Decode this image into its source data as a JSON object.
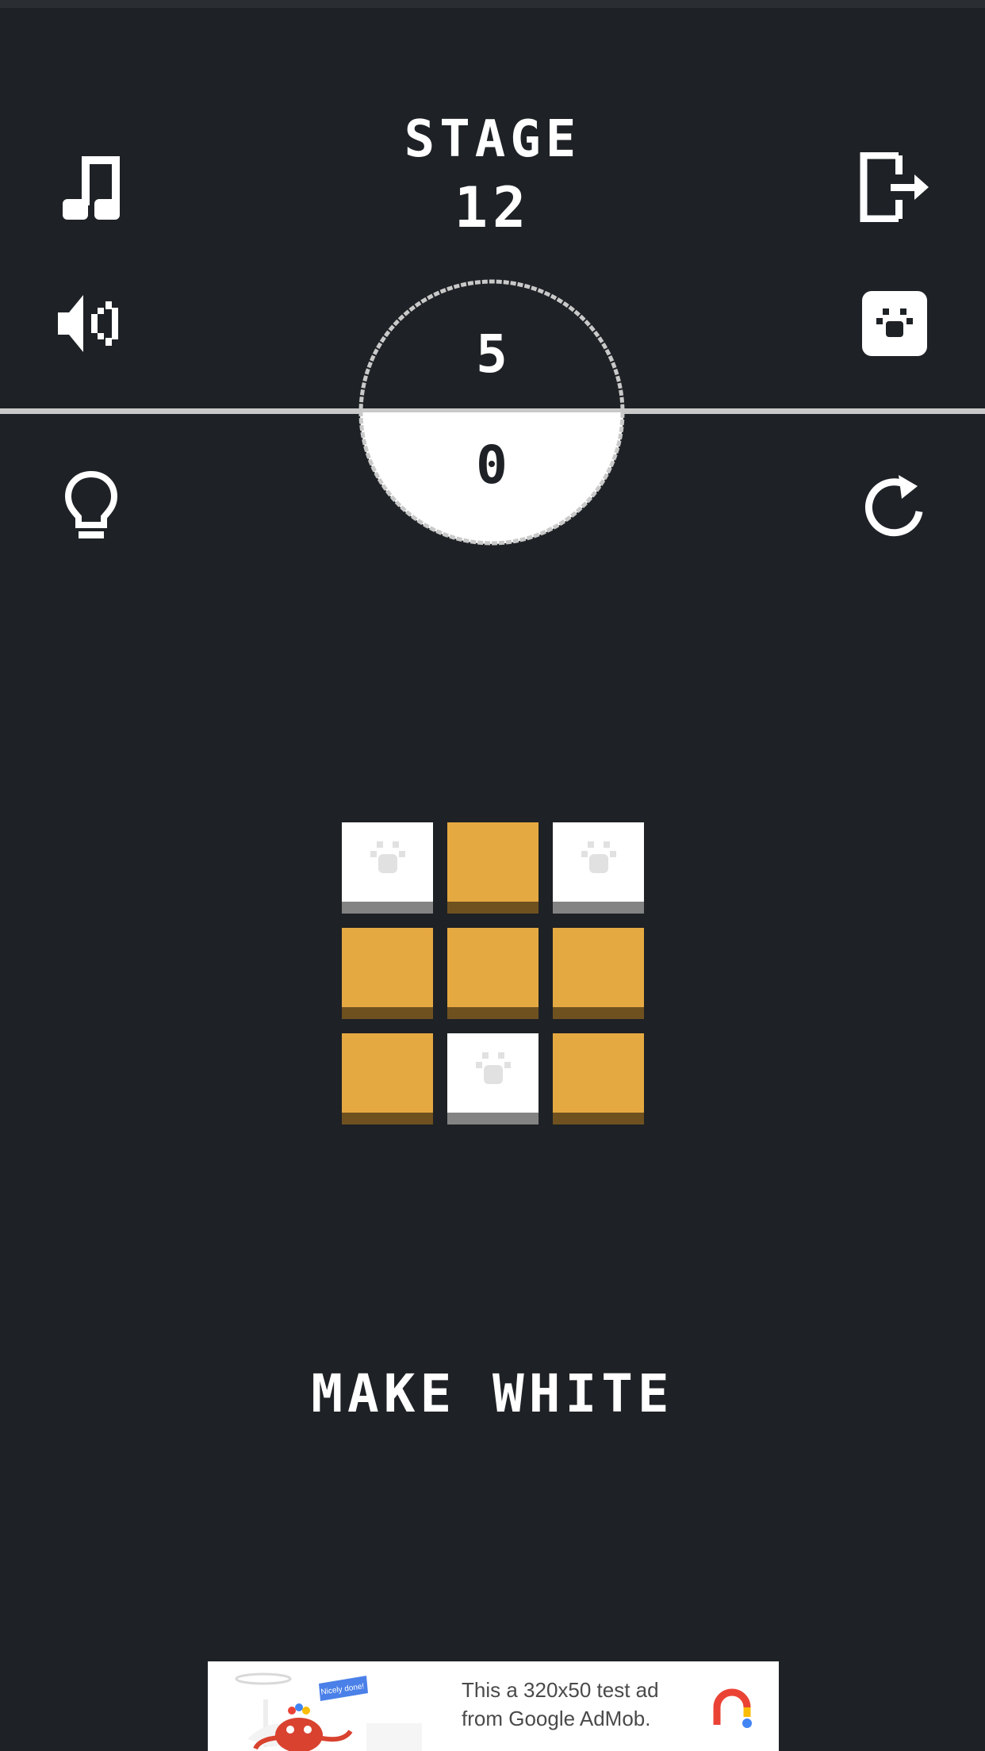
{
  "header": {
    "stage_label": "STAGE",
    "stage_number": "12"
  },
  "toolbar": {
    "music_icon": "music-note-icon",
    "sound_icon": "speaker-icon",
    "hint_icon": "lightbulb-icon",
    "exit_icon": "exit-icon",
    "paw_icon": "paw-badge-icon",
    "restart_icon": "restart-icon"
  },
  "moves": {
    "limit": "5",
    "used": "0"
  },
  "board": {
    "rows": 3,
    "cols": 3,
    "tiles": [
      "white",
      "orange",
      "white",
      "orange",
      "orange",
      "orange",
      "orange",
      "white",
      "orange"
    ]
  },
  "objective": {
    "text": "MAKE WHITE"
  },
  "ad": {
    "text_line1": "This a 320x50 test ad",
    "text_line2": "from Google AdMob.",
    "banner_text": "Nicely done!"
  },
  "colors": {
    "background": "#1e2125",
    "tile_orange": "#e5a942",
    "tile_white": "#ffffff",
    "divider": "#c9c9c9"
  }
}
